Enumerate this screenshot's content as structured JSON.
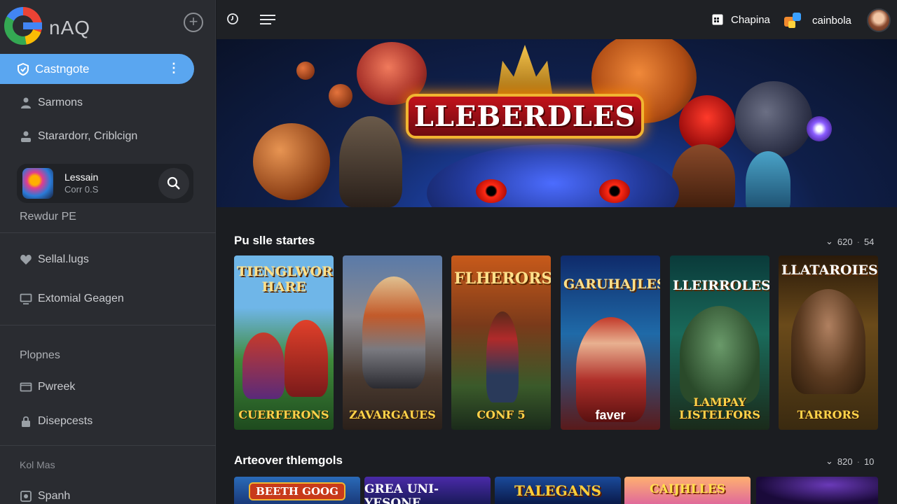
{
  "app": {
    "logo_text": "nAQ",
    "add_icon": "plus-circle-icon"
  },
  "sidebar": {
    "active_item": {
      "label": "Castngote",
      "icon": "shield-icon"
    },
    "items": [
      {
        "label": "Sarmons",
        "icon": "user-icon"
      },
      {
        "label": "Starardorr, Criblcign",
        "icon": "person-icon"
      }
    ],
    "now_playing": {
      "title": "Lessain",
      "subtitle": "Corr 0.S"
    },
    "section1": "Rewdur PE",
    "items2": [
      {
        "label": "Sellal.lugs",
        "icon": "heart-icon"
      },
      {
        "label": "Extomial Geagen",
        "icon": "monitor-icon"
      }
    ],
    "section2": "Plopnes",
    "items3": [
      {
        "label": "Pwreek",
        "icon": "folder-icon"
      },
      {
        "label": "Disepcests",
        "icon": "lock-icon"
      }
    ],
    "section3": "Kol Mas",
    "items4": [
      {
        "label": "Spanh",
        "icon": "grid-icon"
      }
    ]
  },
  "topbar": {
    "user1": "Chapina",
    "user2": "cainbola"
  },
  "hero": {
    "title": "LLEBERDLES"
  },
  "row1": {
    "title": "Pu slle startes",
    "meta_a": "620",
    "meta_b": "54",
    "cards": [
      {
        "title": "TIENGLWOR HARE",
        "sub": "CUERFERONS"
      },
      {
        "title": "",
        "sub": "ZAVARGAUES"
      },
      {
        "title": "FLHERORS",
        "sub": "CONF 5"
      },
      {
        "title": "GARUHAJLES",
        "sub": "faver"
      },
      {
        "title": "LLEIRROLES",
        "sub": "LAMPAY LISTELFORS"
      },
      {
        "title": "LLATAROIES",
        "sub": "TARRORS"
      }
    ]
  },
  "row2": {
    "title": "Arteover thlemgols",
    "meta_a": "820",
    "meta_b": "10",
    "cards": [
      {
        "title": "BEETH GOOG"
      },
      {
        "title": "GREA UNI-YESONE"
      },
      {
        "title": "TALEGANS"
      },
      {
        "title": "CAIJHLLES"
      },
      {
        "title": ""
      }
    ]
  }
}
